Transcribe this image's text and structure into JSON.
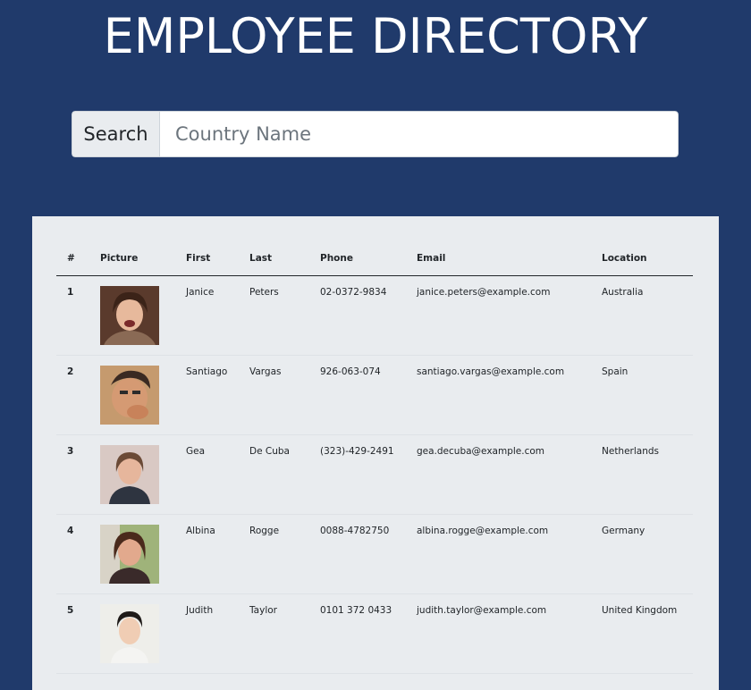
{
  "header": {
    "title": "EMPLOYEE DIRECTORY"
  },
  "search": {
    "label": "Search",
    "placeholder": "Country Name",
    "value": ""
  },
  "table": {
    "columns": [
      "#",
      "Picture",
      "First",
      "Last",
      "Phone",
      "Email",
      "Location"
    ],
    "rows": [
      {
        "num": "1",
        "first": "Janice",
        "last": "Peters",
        "phone": "02-0372-9834",
        "email": "janice.peters@example.com",
        "location": "Australia"
      },
      {
        "num": "2",
        "first": "Santiago",
        "last": "Vargas",
        "phone": "926-063-074",
        "email": "santiago.vargas@example.com",
        "location": "Spain"
      },
      {
        "num": "3",
        "first": "Gea",
        "last": "De Cuba",
        "phone": "(323)-429-2491",
        "email": "gea.decuba@example.com",
        "location": "Netherlands"
      },
      {
        "num": "4",
        "first": "Albina",
        "last": "Rogge",
        "phone": "0088-4782750",
        "email": "albina.rogge@example.com",
        "location": "Germany"
      },
      {
        "num": "5",
        "first": "Judith",
        "last": "Taylor",
        "phone": "0101 372 0433",
        "email": "judith.taylor@example.com",
        "location": "United Kingdom"
      }
    ]
  },
  "colors": {
    "background": "#203a6b",
    "panel": "#e9ecef",
    "text": "#212529"
  }
}
